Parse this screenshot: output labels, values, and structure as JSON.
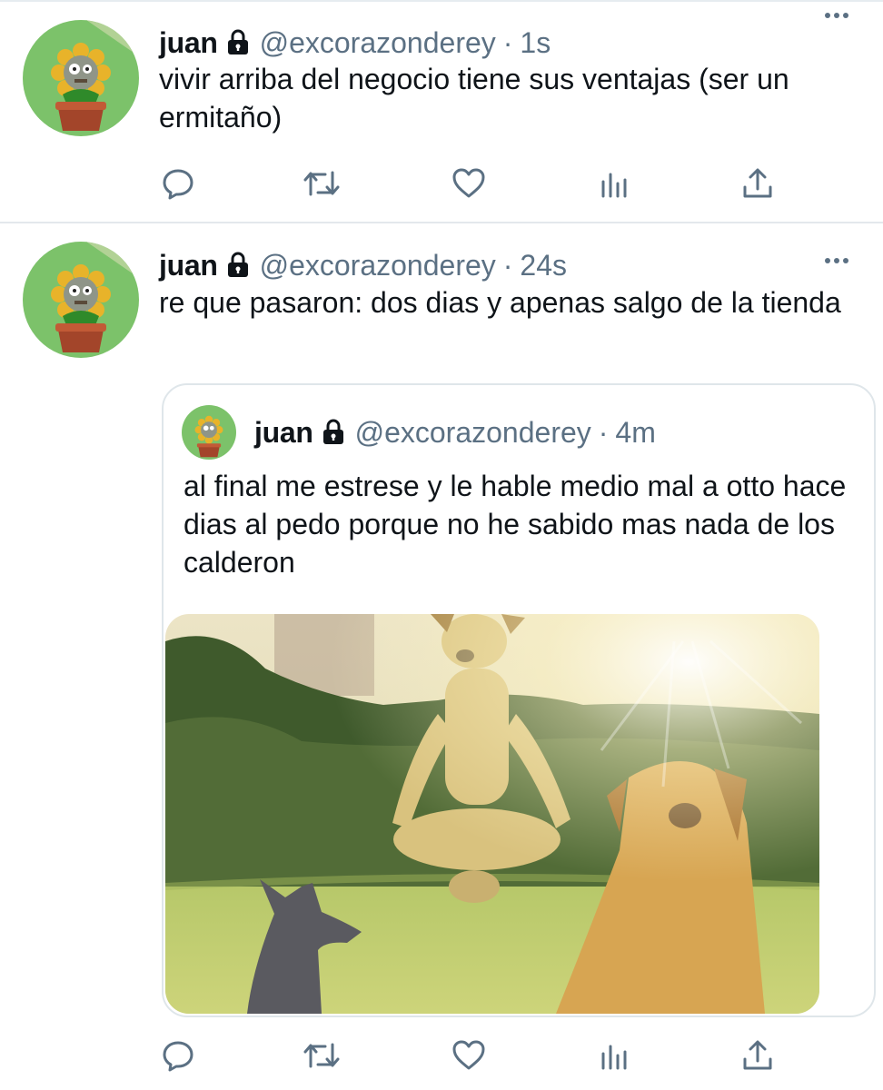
{
  "tweets": [
    {
      "author": {
        "name": "juan",
        "handle": "@excorazonderey",
        "avatar": "sunflower-zombie-avatar",
        "protected": true
      },
      "time": "1s",
      "text": "vivir arriba del negocio tiene sus ventajas (ser un ermitaño)",
      "more": "more-icon"
    },
    {
      "author": {
        "name": "juan",
        "handle": "@excorazonderey",
        "avatar": "sunflower-zombie-avatar",
        "protected": true
      },
      "time": "24s",
      "text": "re que pasaron: dos dias y apenas salgo de la tienda",
      "more": "more-icon",
      "quoted": {
        "author": {
          "name": "juan",
          "handle": "@excorazonderey",
          "protected": true
        },
        "time": "4m",
        "text": "al final me estrese y le hable medio mal a otto hace dias al pedo porque no he sabido mas nada de los calderon",
        "media": "meditating-dog-meme-image"
      }
    }
  ],
  "separator": "·",
  "action_icons": [
    "reply-icon",
    "retweet-icon",
    "like-icon",
    "analytics-icon",
    "share-icon"
  ],
  "colors": {
    "text": "#0f1419",
    "secondary": "#5b7083",
    "border": "#e3e8ec"
  }
}
